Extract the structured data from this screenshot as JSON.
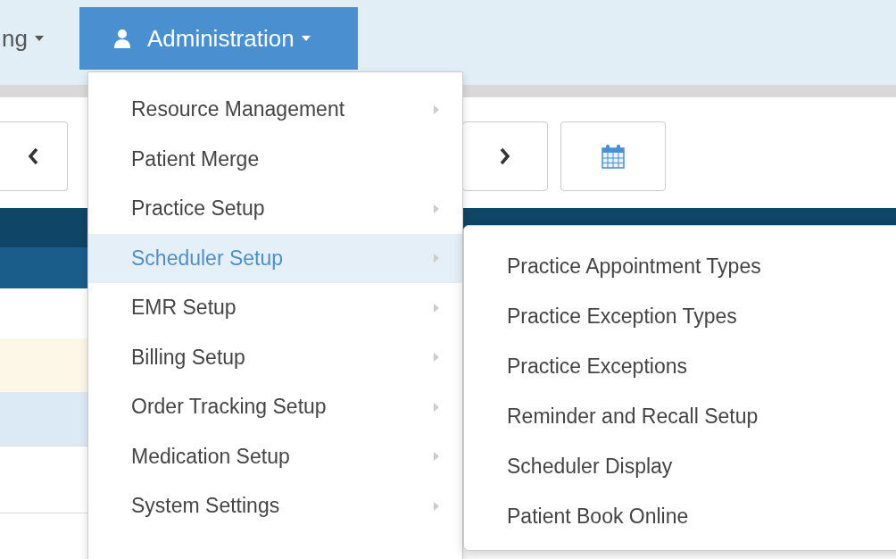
{
  "nav": {
    "tabs": [
      {
        "label": "ng",
        "selected": false
      },
      {
        "label": "Administration",
        "selected": true
      }
    ]
  },
  "menu": {
    "items": [
      {
        "label": "Resource Management",
        "submenu": true,
        "selected": false
      },
      {
        "label": "Patient Merge",
        "submenu": false,
        "selected": false
      },
      {
        "label": "Practice Setup",
        "submenu": true,
        "selected": false
      },
      {
        "label": "Scheduler Setup",
        "submenu": true,
        "selected": true
      },
      {
        "label": "EMR Setup",
        "submenu": true,
        "selected": false
      },
      {
        "label": "Billing Setup",
        "submenu": true,
        "selected": false
      },
      {
        "label": "Order Tracking Setup",
        "submenu": true,
        "selected": false
      },
      {
        "label": "Medication Setup",
        "submenu": true,
        "selected": false
      },
      {
        "label": "System Settings",
        "submenu": true,
        "selected": false
      }
    ]
  },
  "submenu": {
    "items": [
      "Practice Appointment Types",
      "Practice Exception Types",
      "Practice Exceptions",
      "Reminder and Recall Setup",
      "Scheduler Display",
      "Patient Book Online"
    ]
  }
}
